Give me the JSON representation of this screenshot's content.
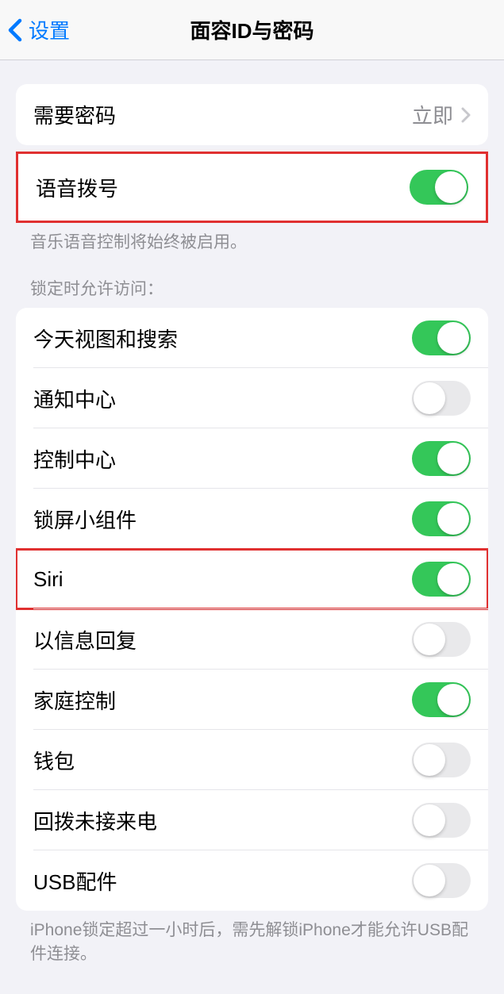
{
  "nav": {
    "back_label": "设置",
    "title": "面容ID与密码"
  },
  "require_passcode": {
    "label": "需要密码",
    "value": "立即"
  },
  "voice_dial": {
    "label": "语音拨号",
    "footer": "音乐语音控制将始终被启用。",
    "on": true
  },
  "lock_access": {
    "header": "锁定时允许访问：",
    "items": [
      {
        "label": "今天视图和搜索",
        "on": true
      },
      {
        "label": "通知中心",
        "on": false
      },
      {
        "label": "控制中心",
        "on": true
      },
      {
        "label": "锁屏小组件",
        "on": true
      },
      {
        "label": "Siri",
        "on": true,
        "highlight": true
      },
      {
        "label": "以信息回复",
        "on": false
      },
      {
        "label": "家庭控制",
        "on": true
      },
      {
        "label": "钱包",
        "on": false
      },
      {
        "label": "回拨未接来电",
        "on": false
      },
      {
        "label": "USB配件",
        "on": false
      }
    ],
    "footer": "iPhone锁定超过一小时后，需先解锁iPhone才能允许USB配件连接。"
  }
}
